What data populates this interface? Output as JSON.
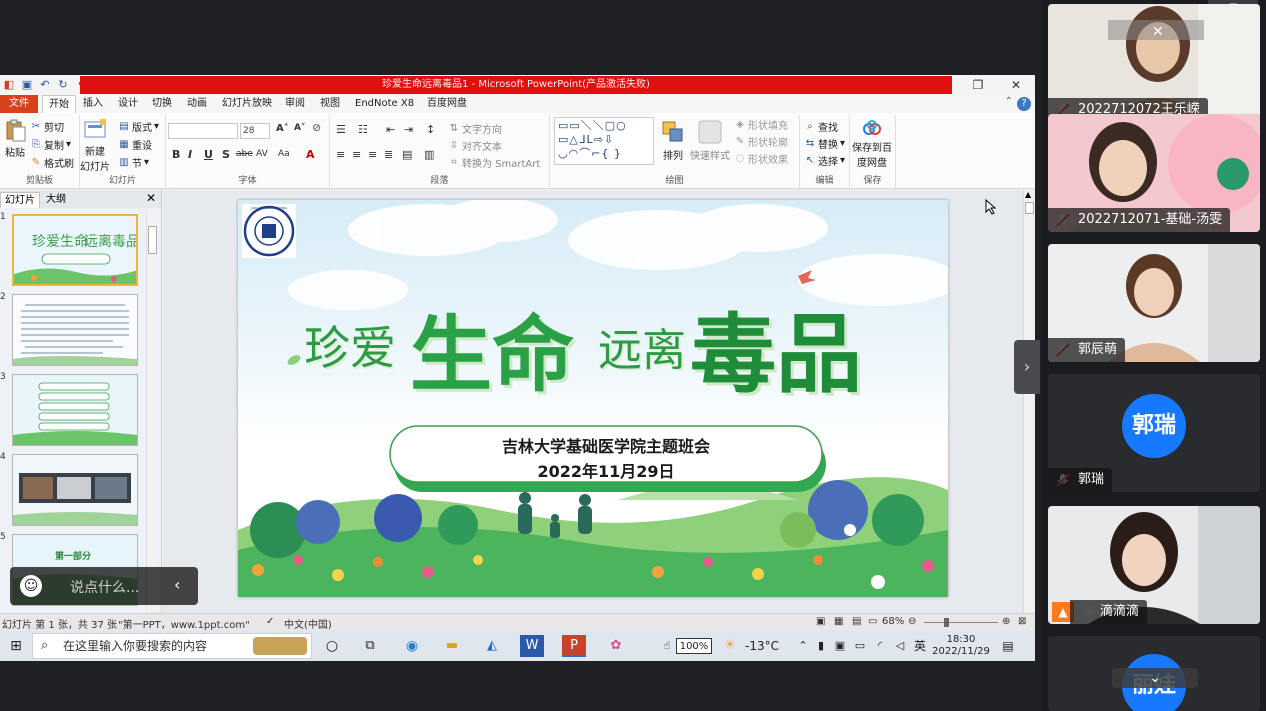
{
  "window": {
    "title": "珍爱生命远离毒品1 - Microsoft PowerPoint(产品激活失败)"
  },
  "tabs": [
    "文件",
    "开始",
    "插入",
    "设计",
    "切换",
    "动画",
    "幻灯片放映",
    "审阅",
    "视图",
    "EndNote X8",
    "百度网盘"
  ],
  "ribbon": {
    "clipboard": {
      "label": "剪贴板",
      "paste": "粘贴",
      "cut": "剪切",
      "copy": "复制",
      "format_painter": "格式刷"
    },
    "slides": {
      "label": "幻灯片",
      "new_slide_1": "新建",
      "new_slide_2": "幻灯片",
      "layout": "版式",
      "reset": "重设",
      "section": "节"
    },
    "font": {
      "label": "字体",
      "size": "28",
      "bold": "B",
      "italic": "I",
      "underline": "U",
      "shadow": "S",
      "strike": "abe",
      "spacing": "AV",
      "case": "Aa",
      "color": "A"
    },
    "paragraph": {
      "label": "段落",
      "text_direction": "文字方向",
      "align_text": "对齐文本",
      "smartart": "转换为 SmartArt"
    },
    "drawing": {
      "label": "绘图",
      "shapes": "▭▭＼＼▢○\n▭△ᒧᒪ⇨⇩\n◡◠⌒⌐{ }",
      "arrange": "排列",
      "quick_styles": "快速样式",
      "fill": "形状填充",
      "outline": "形状轮廓",
      "effects": "形状效果"
    },
    "editing": {
      "label": "编辑",
      "find": "查找",
      "replace": "替换",
      "select": "选择"
    },
    "save": {
      "label": "保存",
      "save_to_baidu_1": "保存到百",
      "save_to_baidu_2": "度网盘"
    }
  },
  "slide_pane": {
    "tab_slides": "幻灯片",
    "tab_outline": "大纲",
    "close": "✕",
    "thumb_numbers": [
      "1",
      "2",
      "3",
      "4",
      "5"
    ],
    "thumb5_text": "第一部分"
  },
  "slide": {
    "title_a": "珍爱",
    "title_b": "生命",
    "title_c": "远离",
    "title_d": "毒品",
    "subtitle": "吉林大学基础医学院主题班会",
    "date": "2022年11月29日",
    "logo_text": "JILIN UNIVERSITY CHINA"
  },
  "statusbar": {
    "slide_info": "幻灯片 第 1 张，共 37 张",
    "theme": "\"第一PPT，www.1ppt.com\"",
    "language": "中文(中国)",
    "zoom": "68%"
  },
  "taskbar": {
    "search_placeholder": "在这里输入你要搜索的内容",
    "battery": "100%",
    "weather": "-13°C",
    "ime": "英",
    "time": "18:30",
    "date": "2022/11/29"
  },
  "chat": {
    "placeholder": "说点什么..."
  },
  "participants": [
    {
      "name": "2022712072王乐嵘"
    },
    {
      "name": "2022712071-基础-汤雯"
    },
    {
      "name": "郭辰萌"
    },
    {
      "name": "郭瑞",
      "avatar": "郭瑞"
    },
    {
      "name": "滴滴滴"
    },
    {
      "name": "",
      "avatar": "丽娃"
    }
  ]
}
